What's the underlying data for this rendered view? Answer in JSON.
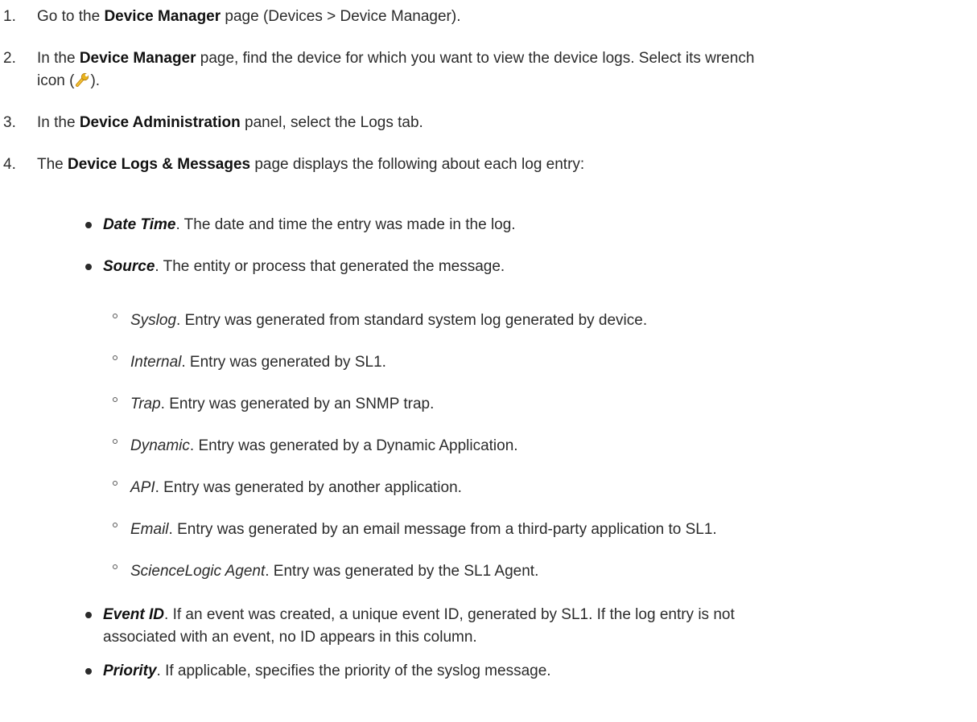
{
  "steps": [
    {
      "num": "1.",
      "pre": "Go to the ",
      "bold": "Device Manager",
      "post": " page (Devices > Device Manager)."
    },
    {
      "num": "2.",
      "pre": "In the ",
      "bold": "Device Manager",
      "post": " page, find the device for which you want to view the device logs. Select its wrench",
      "line2_pre": "icon (",
      "line2_post": ")."
    },
    {
      "num": "3.",
      "pre": "In the ",
      "bold": "Device Administration",
      "post": " panel, select the Logs tab."
    },
    {
      "num": "4.",
      "pre": "The ",
      "bold": "Device Logs & Messages",
      "post": " page displays the following about each log entry:"
    }
  ],
  "bullets": [
    {
      "term": "Date Time",
      "text": ". The date and time the entry was made in the log."
    },
    {
      "term": "Source",
      "text": ". The entity or process that generated the message."
    }
  ],
  "sources": [
    {
      "term": "Syslog",
      "text": ". Entry was generated from standard system log generated by device."
    },
    {
      "term": "Internal",
      "text": ". Entry was generated by SL1."
    },
    {
      "term": "Trap",
      "text": ". Entry was generated by an SNMP trap."
    },
    {
      "term": "Dynamic",
      "text": ". Entry was generated by a Dynamic Application."
    },
    {
      "term": "API",
      "text": ". Entry was generated by another application."
    },
    {
      "term": "Email",
      "text": ". Entry was generated by an email message from a third-party application to SL1."
    },
    {
      "term": "ScienceLogic Agent",
      "text": ". Entry was generated by the SL1 Agent."
    }
  ],
  "more_bullets": [
    {
      "term": "Event ID",
      "text": ". If an event was created, a unique event ID, generated by SL1. If the log entry is not",
      "line2": "associated with an event, no ID appears in this column."
    },
    {
      "term": "Priority",
      "text": ". If applicable, specifies the priority of the syslog message."
    }
  ],
  "icons": {
    "wrench": "wrench-icon"
  },
  "colors": {
    "text": "#2b2b2b",
    "wrench_body": "#e8b21e"
  }
}
